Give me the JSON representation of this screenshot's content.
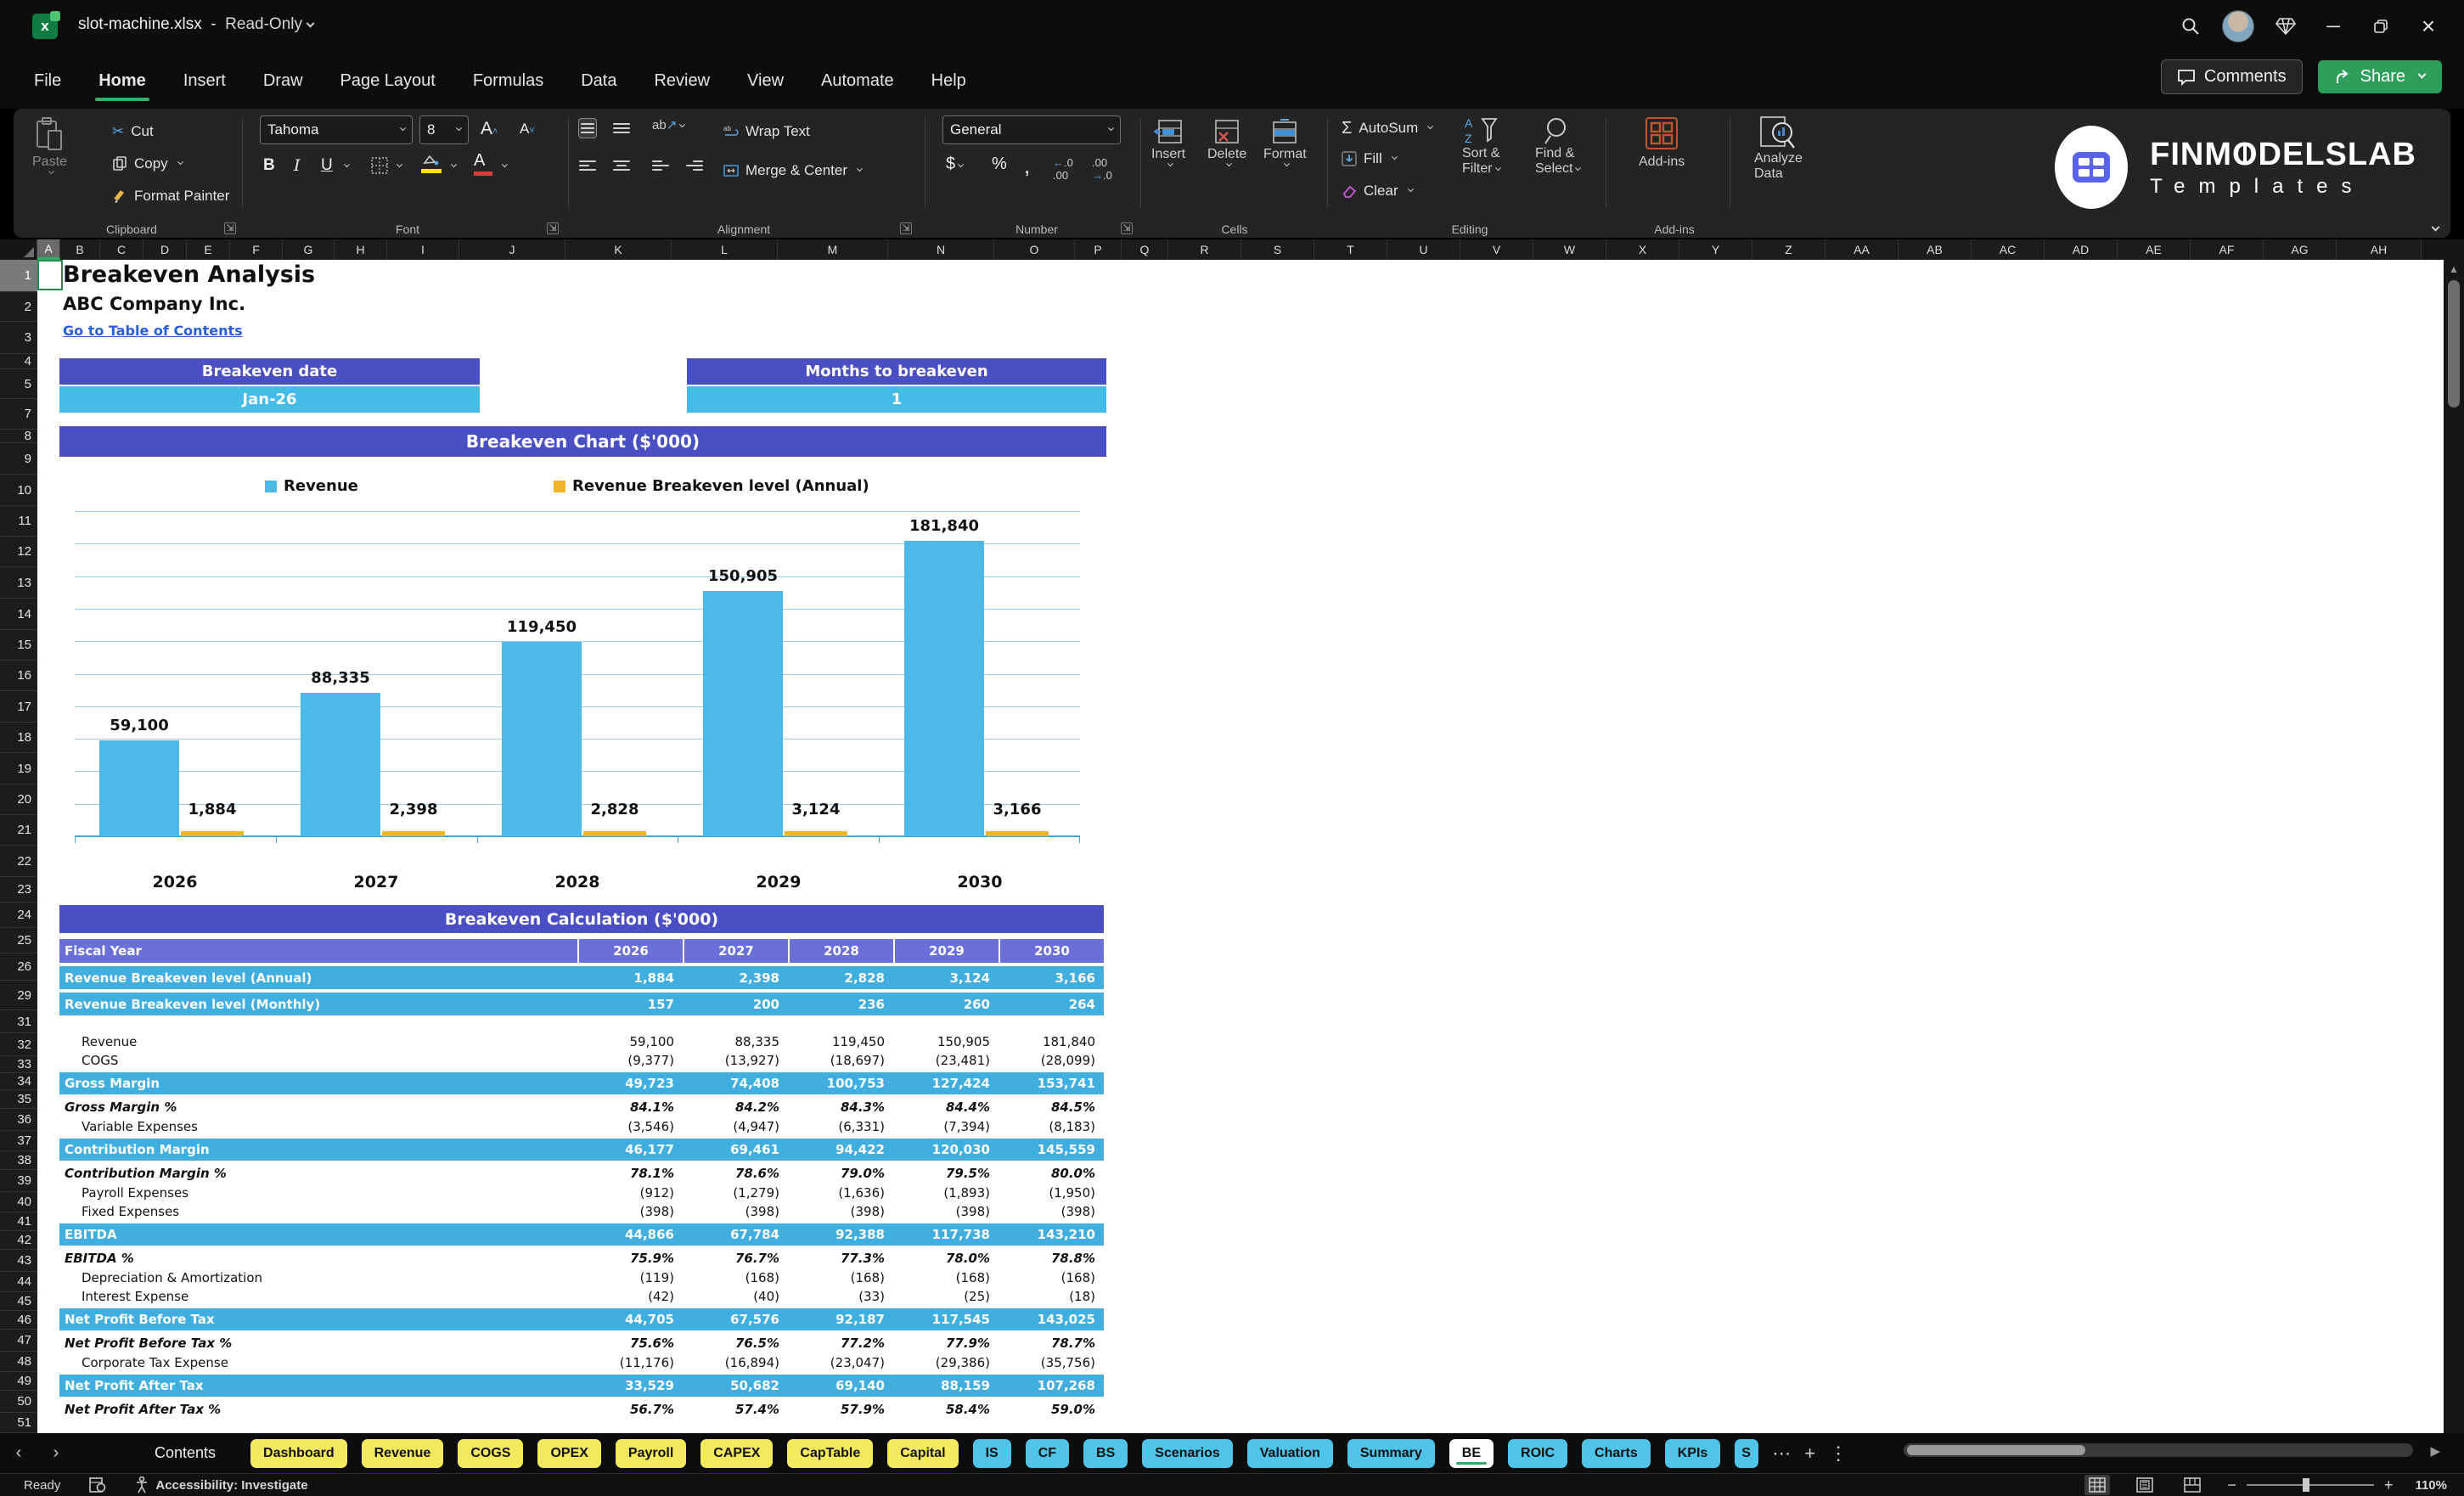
{
  "titlebar": {
    "filename": "slot-machine.xlsx",
    "separator": "-",
    "mode": "Read-Only"
  },
  "menu": {
    "items": [
      "File",
      "Home",
      "Insert",
      "Draw",
      "Page Layout",
      "Formulas",
      "Data",
      "Review",
      "View",
      "Automate",
      "Help"
    ],
    "active_item": "Home",
    "comments_label": "Comments",
    "share_label": "Share"
  },
  "ribbon": {
    "clipboard": {
      "paste": "Paste",
      "cut": "Cut",
      "copy": "Copy",
      "format_painter": "Format Painter",
      "group": "Clipboard"
    },
    "font": {
      "family": "Tahoma",
      "size": "8",
      "bold": "B",
      "italic": "I",
      "underline": "U",
      "group": "Font"
    },
    "alignment": {
      "wrap_text": "Wrap Text",
      "merge_center": "Merge & Center",
      "group": "Alignment"
    },
    "number": {
      "format": "General",
      "group": "Number"
    },
    "cells": {
      "insert": "Insert",
      "delete": "Delete",
      "format": "Format",
      "group": "Cells"
    },
    "editing": {
      "autosum": "AutoSum",
      "fill": "Fill",
      "clear": "Clear",
      "sort_line1": "Sort &",
      "sort_line2": "Filter",
      "find_line1": "Find &",
      "find_line2": "Select",
      "group": "Editing"
    },
    "addins": {
      "button": "Add-ins",
      "group": "Add-ins"
    },
    "analyze": {
      "line1": "Analyze",
      "line2": "Data"
    }
  },
  "logo": {
    "brand_pre": "FINM",
    "brand_o": "O",
    "brand_post": "DELSLAB",
    "tagline": "Templates"
  },
  "grid": {
    "columns": [
      "A",
      "B",
      "C",
      "D",
      "E",
      "F",
      "G",
      "H",
      "I",
      "J",
      "K",
      "L",
      "M",
      "N",
      "O",
      "P",
      "Q",
      "R",
      "S",
      "T",
      "U",
      "V",
      "W",
      "X",
      "Y",
      "Z",
      "AA",
      "AB",
      "AC",
      "AD",
      "AE",
      "AF",
      "AG",
      "AH"
    ],
    "selected_column": "A",
    "rows": [
      "1",
      "2",
      "3",
      "4",
      "5",
      "7",
      "8",
      "9",
      "10",
      "11",
      "12",
      "13",
      "14",
      "15",
      "16",
      "17",
      "18",
      "19",
      "20",
      "21",
      "22",
      "23",
      "24",
      "25",
      "26",
      "29",
      "31",
      "32",
      "33",
      "34",
      "35",
      "36",
      "37",
      "38",
      "39",
      "40",
      "41",
      "42",
      "43",
      "44",
      "45",
      "46",
      "47",
      "48",
      "49",
      "50",
      "51"
    ],
    "selected_row": "1"
  },
  "sheet": {
    "title": "Breakeven Analysis",
    "company": "ABC Company Inc.",
    "link": "Go to Table of Contents",
    "breakeven_date_label": "Breakeven date",
    "breakeven_date_value": "Jan-26",
    "months_label": "Months to breakeven",
    "months_value": "1",
    "chart_title": "Breakeven Chart ($'000)",
    "calc_title": "Breakeven Calculation ($'000)"
  },
  "chart_data": {
    "type": "bar",
    "title": "Breakeven Chart ($'000)",
    "categories": [
      "2026",
      "2027",
      "2028",
      "2029",
      "2030"
    ],
    "series": [
      {
        "name": "Revenue",
        "color": "#4cb9e9",
        "values": [
          59100,
          88335,
          119450,
          150905,
          181840
        ],
        "labels": [
          "59,100",
          "88,335",
          "119,450",
          "150,905",
          "181,840"
        ]
      },
      {
        "name": "Revenue Breakeven level (Annual)",
        "color": "#f0b429",
        "values": [
          1884,
          2398,
          2828,
          3124,
          3166
        ],
        "labels": [
          "1,884",
          "2,398",
          "2,828",
          "3,124",
          "3,166"
        ]
      }
    ],
    "ylim": [
      0,
      200000
    ],
    "gridline_step": 20000,
    "grid": "horizontal",
    "legend_position": "top"
  },
  "table": {
    "header_label": "Fiscal Year",
    "years": [
      "2026",
      "2027",
      "2028",
      "2029",
      "2030"
    ],
    "rows": [
      {
        "label": "Revenue Breakeven level (Annual)",
        "style": "band",
        "values": [
          "1,884",
          "2,398",
          "2,828",
          "3,124",
          "3,166"
        ]
      },
      {
        "label": "Revenue Breakeven level (Monthly)",
        "style": "band",
        "values": [
          "157",
          "200",
          "236",
          "260",
          "264"
        ]
      },
      {
        "label": "",
        "style": "gap",
        "values": []
      },
      {
        "label": "Revenue",
        "style": "normal",
        "values": [
          "59,100",
          "88,335",
          "119,450",
          "150,905",
          "181,840"
        ]
      },
      {
        "label": "COGS",
        "style": "normal",
        "values": [
          "(9,377)",
          "(13,927)",
          "(18,697)",
          "(23,481)",
          "(28,099)"
        ]
      },
      {
        "label": "Gross Margin",
        "style": "subtotal",
        "values": [
          "49,723",
          "74,408",
          "100,753",
          "127,424",
          "153,741"
        ]
      },
      {
        "label": "Gross Margin %",
        "style": "pct",
        "values": [
          "84.1%",
          "84.2%",
          "84.3%",
          "84.4%",
          "84.5%"
        ]
      },
      {
        "label": "Variable Expenses",
        "style": "normal",
        "values": [
          "(3,546)",
          "(4,947)",
          "(6,331)",
          "(7,394)",
          "(8,183)"
        ]
      },
      {
        "label": "Contribution Margin",
        "style": "subtotal",
        "values": [
          "46,177",
          "69,461",
          "94,422",
          "120,030",
          "145,559"
        ]
      },
      {
        "label": "Contribution Margin %",
        "style": "pct",
        "values": [
          "78.1%",
          "78.6%",
          "79.0%",
          "79.5%",
          "80.0%"
        ]
      },
      {
        "label": "Payroll Expenses",
        "style": "normal",
        "values": [
          "(912)",
          "(1,279)",
          "(1,636)",
          "(1,893)",
          "(1,950)"
        ]
      },
      {
        "label": "Fixed Expenses",
        "style": "normal",
        "values": [
          "(398)",
          "(398)",
          "(398)",
          "(398)",
          "(398)"
        ]
      },
      {
        "label": "EBITDA",
        "style": "subtotal",
        "values": [
          "44,866",
          "67,784",
          "92,388",
          "117,738",
          "143,210"
        ]
      },
      {
        "label": "EBITDA %",
        "style": "pct",
        "values": [
          "75.9%",
          "76.7%",
          "77.3%",
          "78.0%",
          "78.8%"
        ]
      },
      {
        "label": "Depreciation & Amortization",
        "style": "normal",
        "values": [
          "(119)",
          "(168)",
          "(168)",
          "(168)",
          "(168)"
        ]
      },
      {
        "label": "Interest Expense",
        "style": "normal",
        "values": [
          "(42)",
          "(40)",
          "(33)",
          "(25)",
          "(18)"
        ]
      },
      {
        "label": "Net Profit Before Tax",
        "style": "subtotal",
        "values": [
          "44,705",
          "67,576",
          "92,187",
          "117,545",
          "143,025"
        ]
      },
      {
        "label": "Net Profit Before Tax %",
        "style": "pct",
        "values": [
          "75.6%",
          "76.5%",
          "77.2%",
          "77.9%",
          "78.7%"
        ]
      },
      {
        "label": "Corporate Tax Expense",
        "style": "normal",
        "values": [
          "(11,176)",
          "(16,894)",
          "(23,047)",
          "(29,386)",
          "(35,756)"
        ]
      },
      {
        "label": "Net Profit After Tax",
        "style": "subtotal",
        "values": [
          "33,529",
          "50,682",
          "69,140",
          "88,159",
          "107,268"
        ]
      },
      {
        "label": "Net Profit After Tax %",
        "style": "pct",
        "values": [
          "56.7%",
          "57.4%",
          "57.9%",
          "58.4%",
          "59.0%"
        ]
      }
    ]
  },
  "tabs": {
    "items": [
      {
        "label": "Contents",
        "style": "plain"
      },
      {
        "label": "Dashboard",
        "style": "yellow"
      },
      {
        "label": "Revenue",
        "style": "yellow"
      },
      {
        "label": "COGS",
        "style": "yellow"
      },
      {
        "label": "OPEX",
        "style": "yellow"
      },
      {
        "label": "Payroll",
        "style": "yellow"
      },
      {
        "label": "CAPEX",
        "style": "yellow"
      },
      {
        "label": "CapTable",
        "style": "yellow"
      },
      {
        "label": "Capital",
        "style": "yellow"
      },
      {
        "label": "IS",
        "style": "blue"
      },
      {
        "label": "CF",
        "style": "blue"
      },
      {
        "label": "BS",
        "style": "blue"
      },
      {
        "label": "Scenarios",
        "style": "blue"
      },
      {
        "label": "Valuation",
        "style": "blue"
      },
      {
        "label": "Summary",
        "style": "blue"
      },
      {
        "label": "BE",
        "style": "active"
      },
      {
        "label": "ROIC",
        "style": "blue"
      },
      {
        "label": "Charts",
        "style": "blue"
      },
      {
        "label": "KPIs",
        "style": "blue"
      },
      {
        "label": "S",
        "style": "blue partial"
      }
    ],
    "active_tab": "BE"
  },
  "statusbar": {
    "ready": "Ready",
    "accessibility": "Accessibility: Investigate",
    "zoom": "110%"
  }
}
